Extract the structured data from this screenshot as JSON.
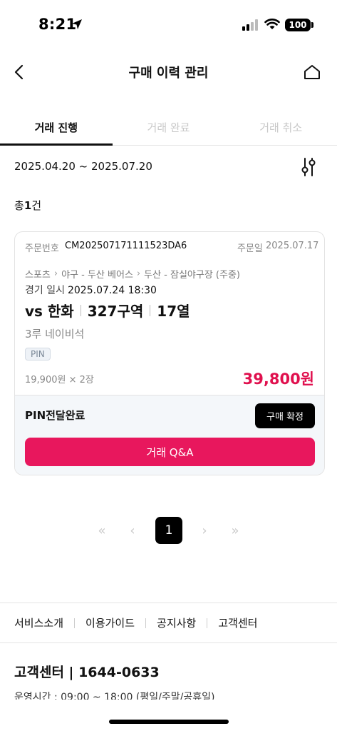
{
  "status_bar": {
    "time": "8:21",
    "battery": "100"
  },
  "header": {
    "title": "구매 이력 관리"
  },
  "tabs": [
    {
      "label": "거래 진행",
      "active": true
    },
    {
      "label": "거래 완료",
      "active": false
    },
    {
      "label": "거래 취소",
      "active": false
    }
  ],
  "filter": {
    "date_range": "2025.04.20 ~ 2025.07.20"
  },
  "summary": {
    "total_prefix": "총",
    "total_count": "1",
    "total_suffix": "건"
  },
  "order": {
    "order_no_label": "주문번호",
    "order_no": "CM20250717111152​3DA6",
    "order_date_label": "주문일",
    "order_date": "2025.07.17",
    "breadcrumb": [
      "스포츠",
      "야구 - 두산 베어스",
      "두산 - 잠실야구장 (주중)"
    ],
    "game_time_label": "경기 일시",
    "game_time": "2025.07.24 18:30",
    "opponent": "vs 한화",
    "section": "327구역",
    "row": "17열",
    "seat_type": "3루 네이비석",
    "tag": "PIN",
    "unit_price": "19,900원 × 2장",
    "total_price": "39,800원",
    "delivery_status": "PIN전달완료",
    "confirm_label": "구매 확정",
    "qa_label": "거래 Q&A"
  },
  "pagination": {
    "first": "«",
    "prev": "‹",
    "current": "1",
    "next": "›",
    "last": "»"
  },
  "footer": {
    "links": [
      "서비스소개",
      "이용가이드",
      "공지사항",
      "고객센터"
    ],
    "cs_label": "고객센터 | 1644-0633",
    "hours": "운영시간 : 09:00 ~ 18:00 (평일/주말/공휴일)"
  },
  "colors": {
    "accent": "#e8175d",
    "price": "#e0104e",
    "dark": "#000000"
  }
}
